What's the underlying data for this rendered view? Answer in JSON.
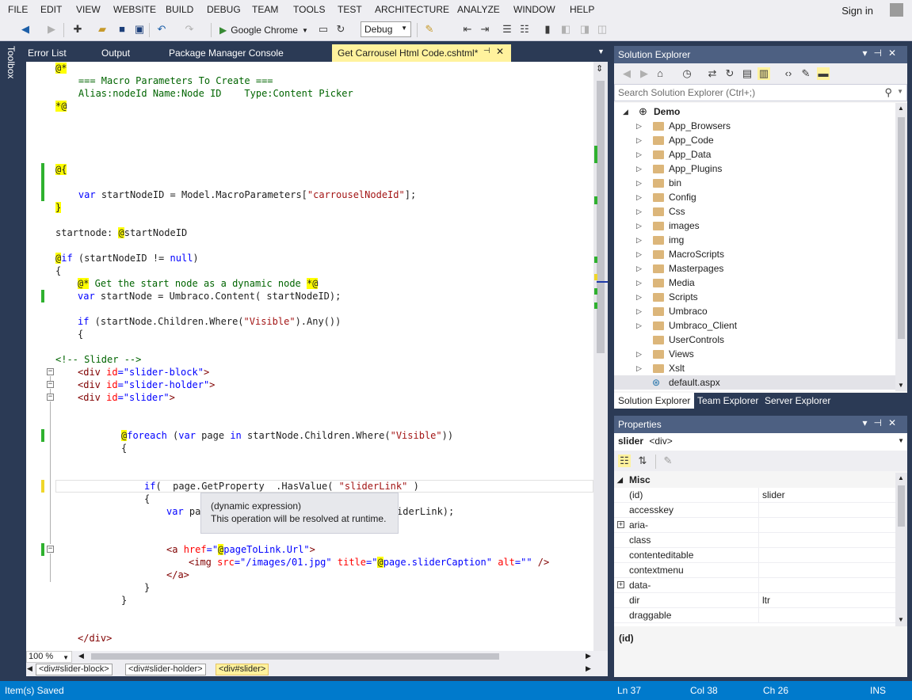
{
  "menu": [
    "FILE",
    "EDIT",
    "VIEW",
    "WEBSITE",
    "BUILD",
    "DEBUG",
    "TEAM",
    "TOOLS",
    "TEST",
    "ARCHITECTURE",
    "ANALYZE",
    "WINDOW",
    "HELP"
  ],
  "signin": "Sign in",
  "toolbar": {
    "run_label": "Google Chrome",
    "config": "Debug"
  },
  "toolbox_label": "Toolbox",
  "doc_tabs": [
    "Error List",
    "Output",
    "Package Manager Console"
  ],
  "active_tab": "Get Carrousel Html Code.cshtml*",
  "code": {
    "l1": "@*",
    "l2": "    === Macro Parameters To Create ===",
    "l3": "    Alias:nodeId Name:Node ID    Type:Content Picker",
    "l4": "*@",
    "l5": "@{",
    "l6a": "    ",
    "l6kw": "var",
    "l6b": " startNodeID = Model.MacroParameters[",
    "l6str": "\"carrouselNodeId\"",
    "l6c": "];",
    "l7": "}",
    "l8a": "startnode: ",
    "l8raz": "@",
    "l8b": "startNodeID",
    "l9raz": "@",
    "l9kw": "if",
    "l9a": " (startNodeID != ",
    "l9kw2": "null",
    "l9b": ")",
    "l10": "{",
    "l11raz": "@*",
    "l11cm": " Get the start node as a dynamic node ",
    "l11raz2": "*@",
    "l12kw": "var",
    "l12a": " startNode = Umbraco.Content( startNodeID);",
    "l13kw": "if",
    "l13a": " (startNode.Children.Where(",
    "l13str": "\"Visible\"",
    "l13b": ").Any())",
    "l14": "{",
    "l15": "<!-- Slider -->",
    "l16a": "<div ",
    "l16attr": "id",
    "l16str": "=\"slider-block\"",
    "l16b": ">",
    "l17a": "<div ",
    "l17attr": "id",
    "l17str": "=\"slider-holder\"",
    "l17b": ">",
    "l18a": "<div ",
    "l18attr": "id",
    "l18str": "=\"slider\"",
    "l18b": ">",
    "l19raz": "@",
    "l19kw": "foreach",
    "l19a": " (",
    "l19kw2": "var",
    "l19b": " page ",
    "l19kw3": "in",
    "l19c": " startNode.Children.Where(",
    "l19str": "\"Visible\"",
    "l19d": "))",
    "l20": "{",
    "l21kw": "if",
    "l21a": "(  page.GetProperty  .HasValue( ",
    "l21str": "\"sliderLink\"",
    "l21b": " )",
    "l22": "{",
    "l23kw": "var",
    "l23a": " pa",
    "l23b": "iderLink);",
    "l24a": "<a ",
    "l24attr": "href",
    "l24s1": "=\"",
    "l24raz": "@",
    "l24s2": "pageToLink.Url\"",
    "l24b": ">",
    "l25a": "<img ",
    "l25attr": "src",
    "l25s": "=\"/images/01.jpg\"",
    "l25attr2": " title",
    "l25s2": "=\"",
    "l25raz": "@",
    "l25s3": "page.sliderCaption\"",
    "l25attr3": " alt",
    "l25s4": "=\"\"",
    "l25b": " />",
    "l26": "</a>",
    "l27": "}",
    "l28": "}",
    "l29": "</div>"
  },
  "tooltip": {
    "line1": "(dynamic expression)",
    "line2": "This operation will be resolved at runtime."
  },
  "zoom": "100 %",
  "breadcrumbs": [
    "<div#slider-block>",
    "<div#slider-holder>",
    "<div#slider>"
  ],
  "solution_explorer": {
    "title": "Solution Explorer",
    "search_placeholder": "Search Solution Explorer (Ctrl+;)",
    "root": "Demo",
    "items": [
      "App_Browsers",
      "App_Code",
      "App_Data",
      "App_Plugins",
      "bin",
      "Config",
      "Css",
      "images",
      "img",
      "MacroScripts",
      "Masterpages",
      "Media",
      "Scripts",
      "Umbraco",
      "Umbraco_Client",
      "UserControls",
      "Views",
      "Xslt"
    ],
    "file": "default.aspx",
    "tabs": [
      "Solution Explorer",
      "Team Explorer",
      "Server Explorer"
    ]
  },
  "properties": {
    "title": "Properties",
    "object_name": "slider",
    "object_type": "<div>",
    "category": "Misc",
    "rows": [
      {
        "name": "(id)",
        "value": "slider"
      },
      {
        "name": "accesskey",
        "value": ""
      },
      {
        "name": "aria-",
        "value": ""
      },
      {
        "name": "class",
        "value": ""
      },
      {
        "name": "contenteditable",
        "value": ""
      },
      {
        "name": "contextmenu",
        "value": ""
      },
      {
        "name": "data-",
        "value": ""
      },
      {
        "name": "dir",
        "value": "ltr"
      },
      {
        "name": "draggable",
        "value": ""
      }
    ],
    "description": "(id)"
  },
  "status": {
    "message": "Item(s) Saved",
    "ln": "Ln 37",
    "col": "Col 38",
    "ch": "Ch 26",
    "mode": "INS"
  },
  "colors": {
    "accent": "#007acc",
    "tab_active": "#fff29d",
    "panel_title": "#4d6082"
  }
}
